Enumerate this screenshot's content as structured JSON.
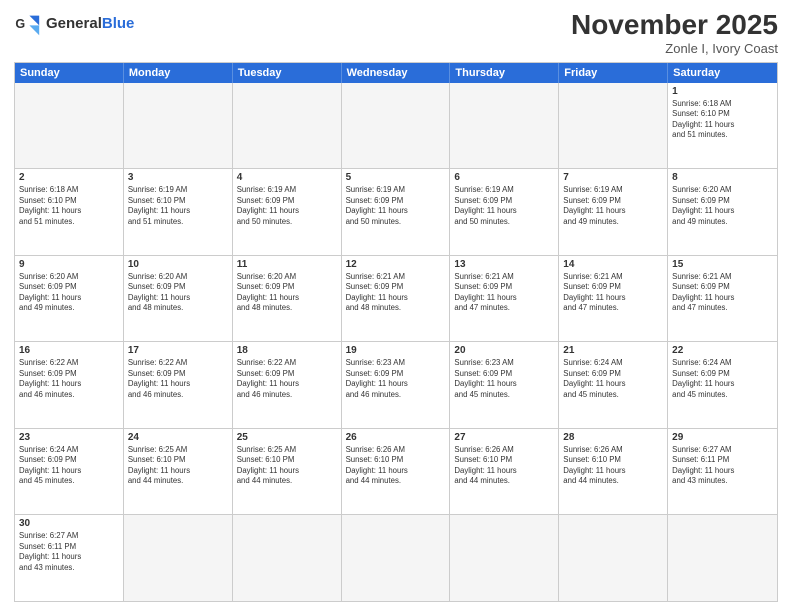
{
  "header": {
    "logo_general": "General",
    "logo_blue": "Blue",
    "month_title": "November 2025",
    "location": "Zonle I, Ivory Coast"
  },
  "days_of_week": [
    "Sunday",
    "Monday",
    "Tuesday",
    "Wednesday",
    "Thursday",
    "Friday",
    "Saturday"
  ],
  "weeks": [
    [
      {
        "day": "",
        "info": "",
        "empty": true
      },
      {
        "day": "",
        "info": "",
        "empty": true
      },
      {
        "day": "",
        "info": "",
        "empty": true
      },
      {
        "day": "",
        "info": "",
        "empty": true
      },
      {
        "day": "",
        "info": "",
        "empty": true
      },
      {
        "day": "",
        "info": "",
        "empty": true
      },
      {
        "day": "1",
        "info": "Sunrise: 6:18 AM\nSunset: 6:10 PM\nDaylight: 11 hours\nand 51 minutes.",
        "empty": false
      }
    ],
    [
      {
        "day": "2",
        "info": "Sunrise: 6:18 AM\nSunset: 6:10 PM\nDaylight: 11 hours\nand 51 minutes.",
        "empty": false
      },
      {
        "day": "3",
        "info": "Sunrise: 6:19 AM\nSunset: 6:10 PM\nDaylight: 11 hours\nand 51 minutes.",
        "empty": false
      },
      {
        "day": "4",
        "info": "Sunrise: 6:19 AM\nSunset: 6:09 PM\nDaylight: 11 hours\nand 50 minutes.",
        "empty": false
      },
      {
        "day": "5",
        "info": "Sunrise: 6:19 AM\nSunset: 6:09 PM\nDaylight: 11 hours\nand 50 minutes.",
        "empty": false
      },
      {
        "day": "6",
        "info": "Sunrise: 6:19 AM\nSunset: 6:09 PM\nDaylight: 11 hours\nand 50 minutes.",
        "empty": false
      },
      {
        "day": "7",
        "info": "Sunrise: 6:19 AM\nSunset: 6:09 PM\nDaylight: 11 hours\nand 49 minutes.",
        "empty": false
      },
      {
        "day": "8",
        "info": "Sunrise: 6:20 AM\nSunset: 6:09 PM\nDaylight: 11 hours\nand 49 minutes.",
        "empty": false
      }
    ],
    [
      {
        "day": "9",
        "info": "Sunrise: 6:20 AM\nSunset: 6:09 PM\nDaylight: 11 hours\nand 49 minutes.",
        "empty": false
      },
      {
        "day": "10",
        "info": "Sunrise: 6:20 AM\nSunset: 6:09 PM\nDaylight: 11 hours\nand 48 minutes.",
        "empty": false
      },
      {
        "day": "11",
        "info": "Sunrise: 6:20 AM\nSunset: 6:09 PM\nDaylight: 11 hours\nand 48 minutes.",
        "empty": false
      },
      {
        "day": "12",
        "info": "Sunrise: 6:21 AM\nSunset: 6:09 PM\nDaylight: 11 hours\nand 48 minutes.",
        "empty": false
      },
      {
        "day": "13",
        "info": "Sunrise: 6:21 AM\nSunset: 6:09 PM\nDaylight: 11 hours\nand 47 minutes.",
        "empty": false
      },
      {
        "day": "14",
        "info": "Sunrise: 6:21 AM\nSunset: 6:09 PM\nDaylight: 11 hours\nand 47 minutes.",
        "empty": false
      },
      {
        "day": "15",
        "info": "Sunrise: 6:21 AM\nSunset: 6:09 PM\nDaylight: 11 hours\nand 47 minutes.",
        "empty": false
      }
    ],
    [
      {
        "day": "16",
        "info": "Sunrise: 6:22 AM\nSunset: 6:09 PM\nDaylight: 11 hours\nand 46 minutes.",
        "empty": false
      },
      {
        "day": "17",
        "info": "Sunrise: 6:22 AM\nSunset: 6:09 PM\nDaylight: 11 hours\nand 46 minutes.",
        "empty": false
      },
      {
        "day": "18",
        "info": "Sunrise: 6:22 AM\nSunset: 6:09 PM\nDaylight: 11 hours\nand 46 minutes.",
        "empty": false
      },
      {
        "day": "19",
        "info": "Sunrise: 6:23 AM\nSunset: 6:09 PM\nDaylight: 11 hours\nand 46 minutes.",
        "empty": false
      },
      {
        "day": "20",
        "info": "Sunrise: 6:23 AM\nSunset: 6:09 PM\nDaylight: 11 hours\nand 45 minutes.",
        "empty": false
      },
      {
        "day": "21",
        "info": "Sunrise: 6:24 AM\nSunset: 6:09 PM\nDaylight: 11 hours\nand 45 minutes.",
        "empty": false
      },
      {
        "day": "22",
        "info": "Sunrise: 6:24 AM\nSunset: 6:09 PM\nDaylight: 11 hours\nand 45 minutes.",
        "empty": false
      }
    ],
    [
      {
        "day": "23",
        "info": "Sunrise: 6:24 AM\nSunset: 6:09 PM\nDaylight: 11 hours\nand 45 minutes.",
        "empty": false
      },
      {
        "day": "24",
        "info": "Sunrise: 6:25 AM\nSunset: 6:10 PM\nDaylight: 11 hours\nand 44 minutes.",
        "empty": false
      },
      {
        "day": "25",
        "info": "Sunrise: 6:25 AM\nSunset: 6:10 PM\nDaylight: 11 hours\nand 44 minutes.",
        "empty": false
      },
      {
        "day": "26",
        "info": "Sunrise: 6:26 AM\nSunset: 6:10 PM\nDaylight: 11 hours\nand 44 minutes.",
        "empty": false
      },
      {
        "day": "27",
        "info": "Sunrise: 6:26 AM\nSunset: 6:10 PM\nDaylight: 11 hours\nand 44 minutes.",
        "empty": false
      },
      {
        "day": "28",
        "info": "Sunrise: 6:26 AM\nSunset: 6:10 PM\nDaylight: 11 hours\nand 44 minutes.",
        "empty": false
      },
      {
        "day": "29",
        "info": "Sunrise: 6:27 AM\nSunset: 6:11 PM\nDaylight: 11 hours\nand 43 minutes.",
        "empty": false
      }
    ],
    [
      {
        "day": "30",
        "info": "Sunrise: 6:27 AM\nSunset: 6:11 PM\nDaylight: 11 hours\nand 43 minutes.",
        "empty": false
      },
      {
        "day": "",
        "info": "",
        "empty": true
      },
      {
        "day": "",
        "info": "",
        "empty": true
      },
      {
        "day": "",
        "info": "",
        "empty": true
      },
      {
        "day": "",
        "info": "",
        "empty": true
      },
      {
        "day": "",
        "info": "",
        "empty": true
      },
      {
        "day": "",
        "info": "",
        "empty": true
      }
    ]
  ]
}
